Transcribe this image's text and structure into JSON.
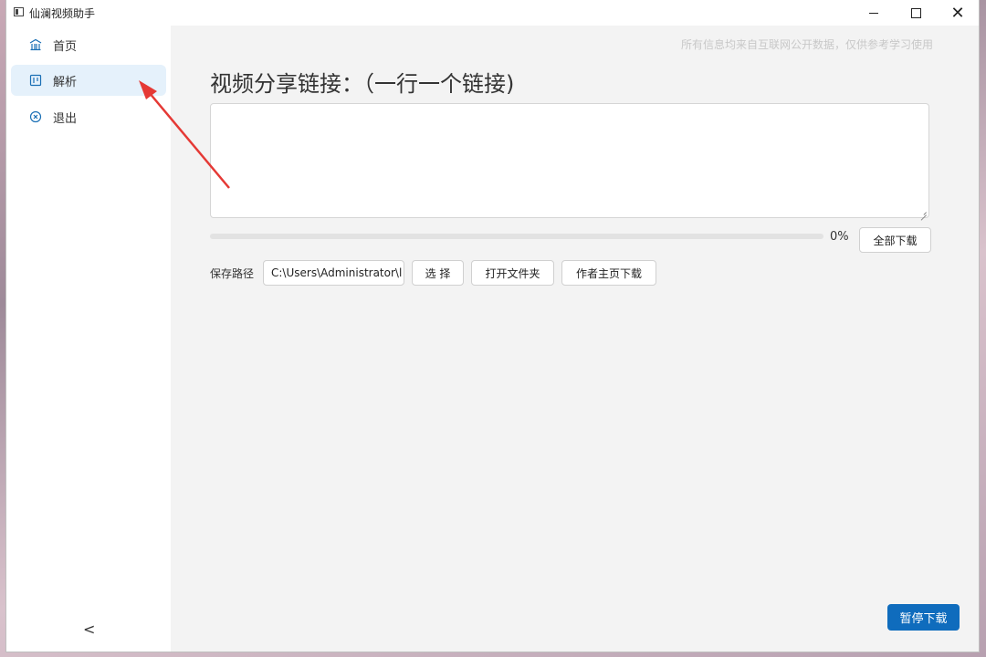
{
  "window": {
    "title": "仙澜视频助手",
    "controls": {
      "minimize": "—",
      "maximize": "☐",
      "close": "✕"
    }
  },
  "sidebar": {
    "items": [
      {
        "label": "首页",
        "icon": "home-icon",
        "active": false
      },
      {
        "label": "解析",
        "icon": "parse-icon",
        "active": true
      },
      {
        "label": "退出",
        "icon": "exit-icon",
        "active": false
      }
    ],
    "collapse_glyph": "<"
  },
  "main": {
    "notice": "所有信息均来自互联网公开数据，仅供参考学习使用",
    "heading": "视频分享链接：（一行一个链接)",
    "links_input": {
      "value": "",
      "placeholder": ""
    },
    "progress": {
      "value": 0,
      "text": "0%"
    },
    "download_all_label": "全部下载",
    "save_path": {
      "label": "保存路径",
      "value": "C:\\Users\\Administrator\\l"
    },
    "choose_label": "选 择",
    "open_folder_label": "打开文件夹",
    "author_download_label": "作者主页下载",
    "pause_label": "暂停下载"
  },
  "colors": {
    "accent": "#0f6cbd",
    "active_nav_bg": "#e5f1fb",
    "content_bg": "#f3f3f3",
    "annotation_arrow": "#e53935"
  }
}
